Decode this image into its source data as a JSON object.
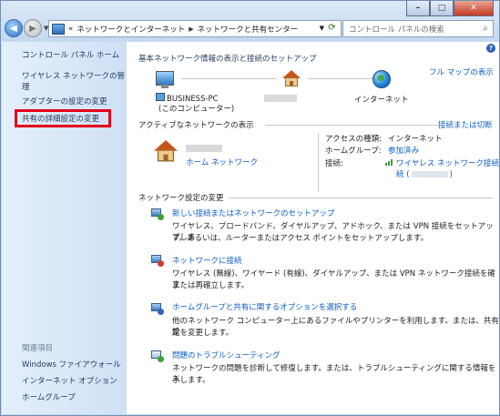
{
  "window": {
    "controls": {
      "minimize": "–",
      "maximize": "□",
      "close": "✕"
    },
    "breadcrumb": {
      "lead": "«",
      "items": [
        "ネットワークとインターネット",
        "ネットワークと共有センター"
      ]
    },
    "search_placeholder": "コントロール パネルの検索"
  },
  "sidebar": {
    "items": [
      "コントロール パネル ホーム",
      "ワイヤレス ネットワークの管理",
      "アダプターの設定の変更",
      "共有の詳細設定の変更"
    ],
    "related_heading": "関連項目",
    "related": [
      "Windows ファイアウォール",
      "インターネット オプション",
      "ホームグループ"
    ]
  },
  "main": {
    "heading": "基本ネットワーク情報の表示と接続のセットアップ",
    "full_map": "フル マップの表示",
    "pc_name": "BUSINESS-PC",
    "pc_sub": "(このコンピューター)",
    "internet": "インターネット",
    "active_heading": "アクティブなネットワークの表示",
    "connect_disconnect": "接続または切断",
    "home_network": "ホーム ネットワーク",
    "access_type_label": "アクセスの種類:",
    "access_type_value": "インターネット",
    "homegroup_label": "ホームグループ:",
    "homegroup_value": "参加済み",
    "connection_label": "接続:",
    "connection_value": "ワイヤレス ネットワーク接続",
    "connection_value2_open": "続 (",
    "connection_value2_close": ")",
    "settings_heading": "ネットワーク設定の変更",
    "tasks": [
      {
        "title": "新しい接続またはネットワークのセットアップ",
        "desc1": "ワイヤレス、ブロードバンド、ダイヤルアップ、アドホック、または VPN 接続をセットアップしま",
        "desc2": "す。あるいは、ルーターまたはアクセス ポイントをセットアップします。"
      },
      {
        "title": "ネットワークに接続",
        "desc1": "ワイヤレス (無線)、ワイヤード (有線)、ダイヤルアップ、または VPN ネットワーク接続を確立",
        "desc2": "または再確立します。"
      },
      {
        "title": "ホームグループと共有に関するオプションを選択する",
        "desc1": "他のネットワーク コンピューター上にあるファイルやプリンターを利用します。または、共有設",
        "desc2": "定を変更します。"
      },
      {
        "title": "問題のトラブルシューティング",
        "desc1": "ネットワークの問題を診断して修復します。または、トラブルシューティングに関する情報を入",
        "desc2": "手します。"
      }
    ]
  },
  "colors": {
    "link": "#0a5bc8",
    "highlight_border": "#e4001b",
    "sidebar_bg": "#dce9f8"
  }
}
